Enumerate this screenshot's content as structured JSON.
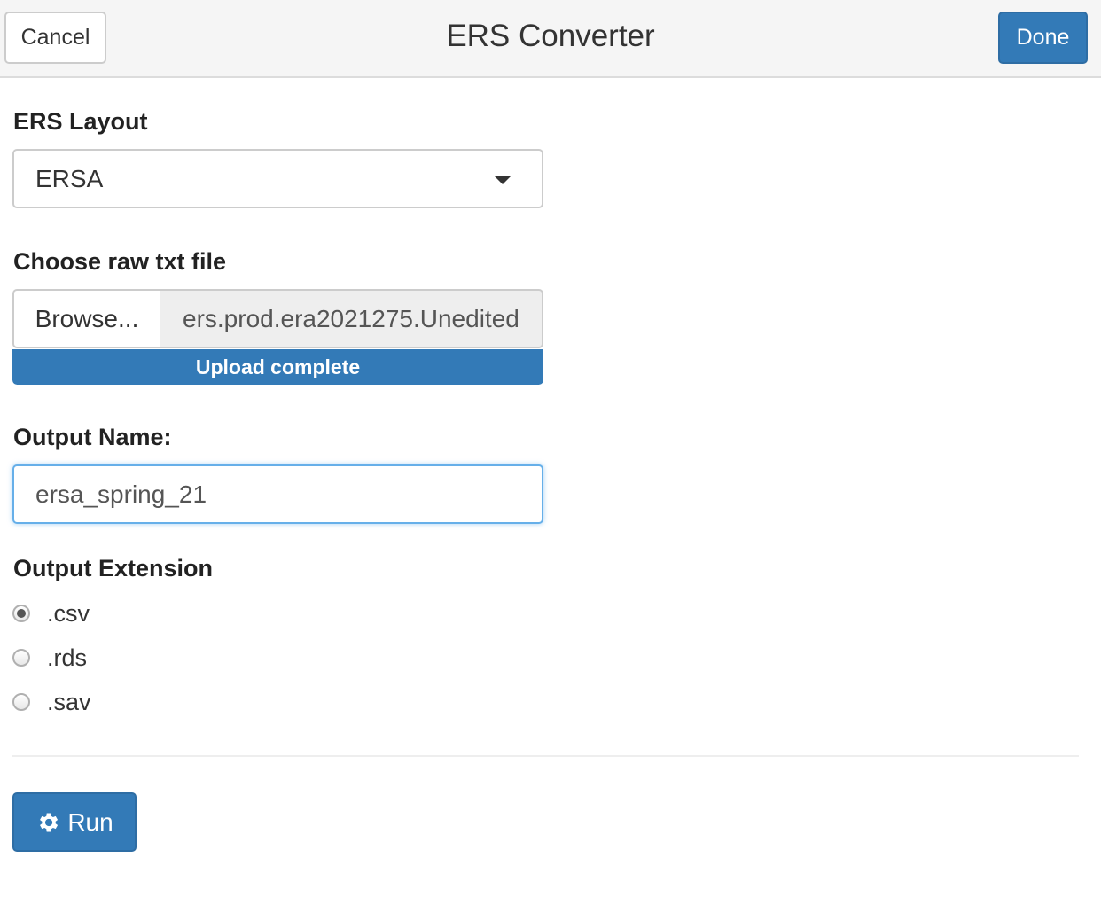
{
  "header": {
    "title": "ERS Converter",
    "cancel_label": "Cancel",
    "done_label": "Done"
  },
  "layout_field": {
    "label": "ERS Layout",
    "selected": "ERSA"
  },
  "file_field": {
    "label": "Choose raw txt file",
    "browse_label": "Browse...",
    "file_name": "ers.prod.era2021275.Unedited",
    "progress_text": "Upload complete",
    "progress_percent": 100
  },
  "output_name": {
    "label": "Output Name:",
    "value": "ersa_spring_21"
  },
  "output_extension": {
    "label": "Output Extension",
    "options": [
      {
        "label": ".csv",
        "checked": true
      },
      {
        "label": ".rds",
        "checked": false
      },
      {
        "label": ".sav",
        "checked": false
      }
    ]
  },
  "run_button": {
    "label": "Run",
    "icon": "gear-icon"
  },
  "colors": {
    "primary": "#337ab7",
    "header_bg": "#f5f5f5",
    "focus_border": "#66afe9"
  }
}
